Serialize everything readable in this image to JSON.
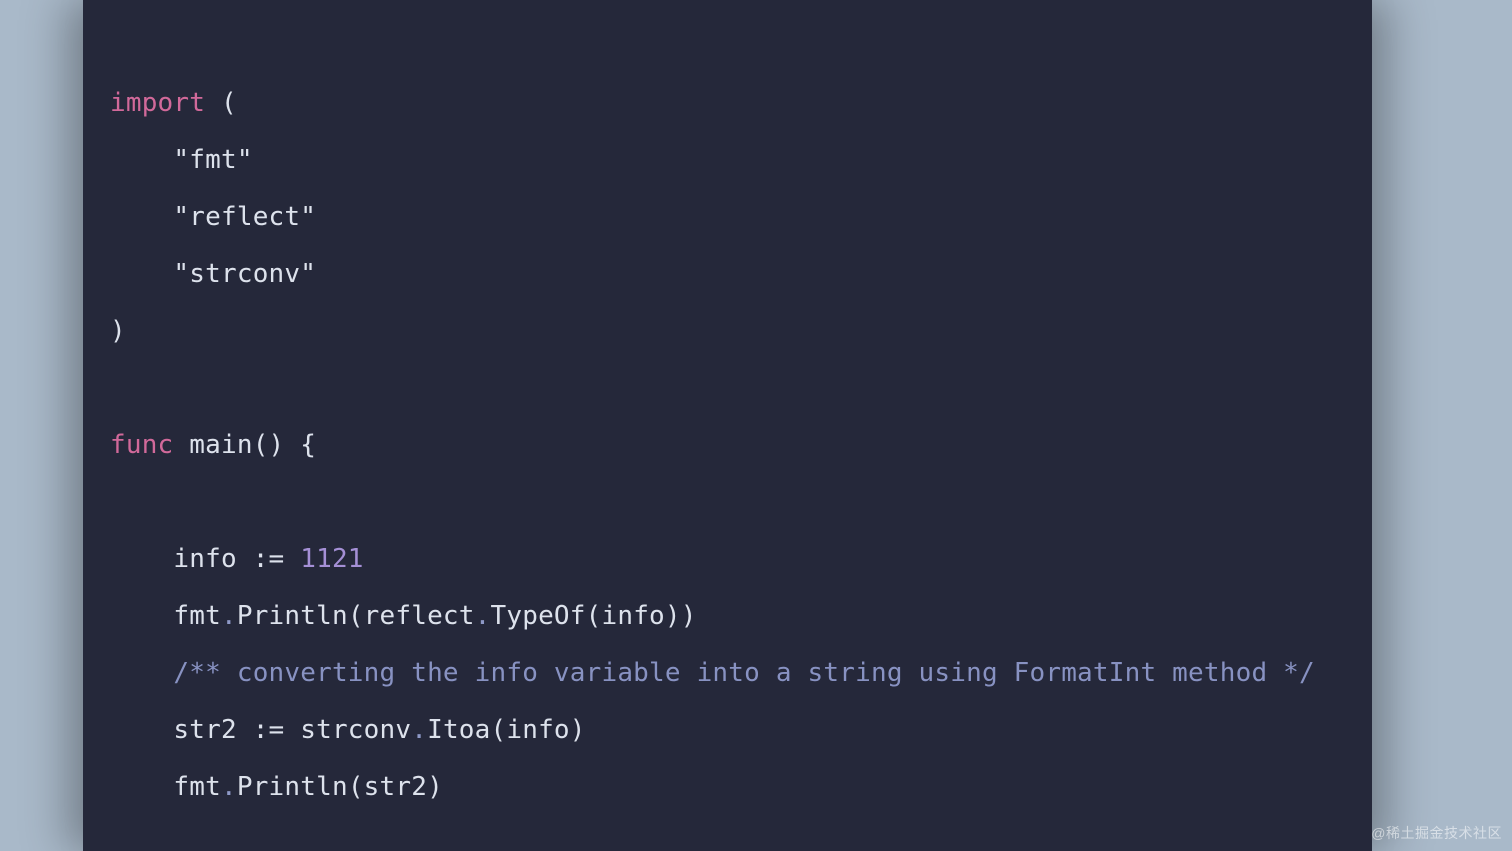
{
  "code": {
    "line1_import": "import",
    "line1_paren": " (",
    "line2_indent": "    ",
    "line2_str": "\"fmt\"",
    "line3_indent": "    ",
    "line3_str": "\"reflect\"",
    "line4_indent": "    ",
    "line4_str": "\"strconv\"",
    "line5_close": ")",
    "blank": "",
    "line7_func": "func",
    "line7_rest": " main() {",
    "line10_indent": "    ",
    "line10_a": "info := ",
    "line10_num": "1121",
    "line11_indent": "    ",
    "line11_a": "fmt",
    "line11_dot1": ".",
    "line11_b": "Println(reflect",
    "line11_dot2": ".",
    "line11_c": "TypeOf(info))",
    "line12_indent": "    ",
    "line12_comment": "/** converting the info variable into a string using FormatInt method */",
    "line13_indent": "    ",
    "line13_a": "str2 := strconv",
    "line13_dot": ".",
    "line13_b": "Itoa(info)",
    "line14_indent": "    ",
    "line14_a": "fmt",
    "line14_dot": ".",
    "line14_b": "Println(str2)"
  },
  "watermark": "@稀土掘金技术社区"
}
